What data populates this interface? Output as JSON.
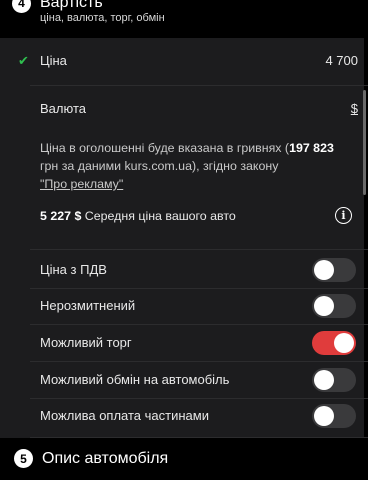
{
  "section4": {
    "number": "4",
    "title": "Вартість",
    "subtitle": "ціна, валюта, торг, обмін"
  },
  "price": {
    "label": "Ціна",
    "value": "4 700"
  },
  "currency": {
    "label": "Валюта",
    "value": "$"
  },
  "info": {
    "text_before": "Ціна в оголошенні буде вказана в гривнях (",
    "uah_amount": "197 823",
    "text_middle": " грн за даними kurs.com.ua), згідно закону ",
    "law_link": "\"Про рекламу\""
  },
  "average": {
    "amount": "5 227 $",
    "label": " Середня ціна вашого авто"
  },
  "options": [
    {
      "label": "Ціна з ПДВ",
      "on": false
    },
    {
      "label": "Нерозмитнений",
      "on": false
    },
    {
      "label": "Можливий торг",
      "on": true
    },
    {
      "label": "Можливий обмін на автомобіль",
      "on": false
    },
    {
      "label": "Можлива оплата частинами",
      "on": false
    }
  ],
  "section5": {
    "number": "5",
    "title": "Опис автомобіля"
  },
  "colors": {
    "toggle_on": "#e03c3c",
    "check": "#2fbf4f",
    "panel": "#1c1c1e"
  }
}
